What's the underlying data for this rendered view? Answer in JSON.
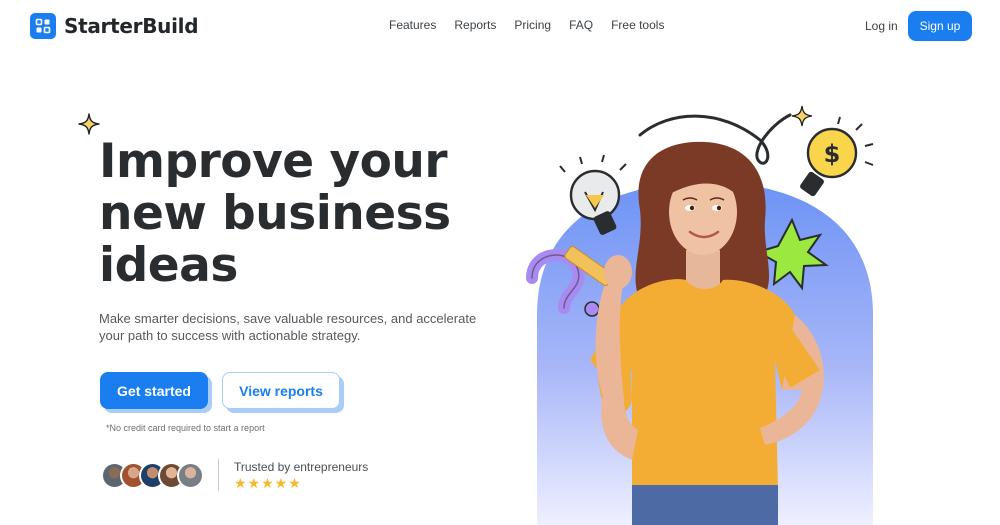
{
  "brand": {
    "name": "StarterBuild",
    "color": "#1a7ef0"
  },
  "nav": {
    "items": [
      "Features",
      "Reports",
      "Pricing",
      "FAQ",
      "Free tools"
    ],
    "login": "Log in",
    "signup": "Sign up"
  },
  "hero": {
    "headline": [
      "Improve your",
      "new business",
      "ideas"
    ],
    "subtext": "Make smarter decisions, save valuable resources, and accelerate your path to success with actionable strategy.",
    "primary_cta": "Get started",
    "secondary_cta": "View reports",
    "note": "*No credit card required to start a report",
    "trusted": "Trusted by entrepreneurs",
    "rating": "★★★★★"
  },
  "icons": [
    "logo-grid-icon",
    "sparkle-icon",
    "lightbulb-icon",
    "dollar-lightbulb-icon",
    "question-mark-icon",
    "starburst-icon",
    "star-icon"
  ]
}
